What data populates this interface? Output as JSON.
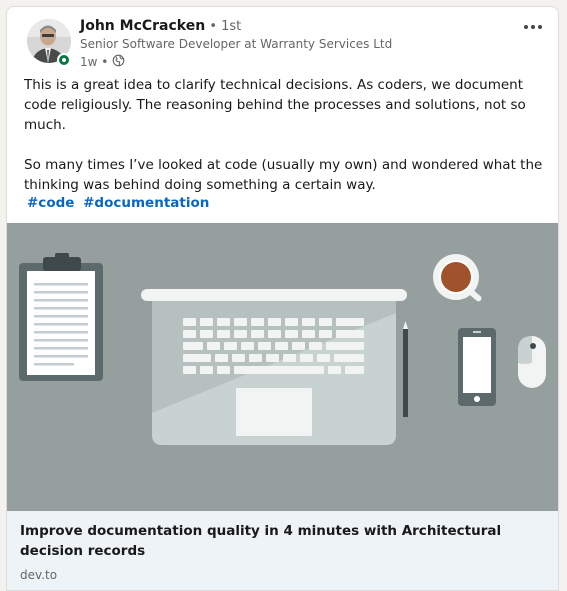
{
  "post": {
    "author": {
      "name": "John McCracken",
      "degree": " • 1st",
      "headline": "Senior Software Developer at Warranty Services Ltd",
      "time": "1w •",
      "visibility_icon": "globe-icon",
      "online": true
    },
    "menu_icon": "more-options-icon",
    "body": [
      "This is a great idea to clarify technical decisions. As coders, we document code religiously. The reasoning behind the processes and solutions, not so much.",
      "So many times I’ve looked at code (usually my own) and wondered what the thinking was behind doing something a certain way."
    ],
    "hashtags": [
      "#code",
      "#documentation"
    ],
    "link_preview": {
      "title": "Improve documentation quality in 4 minutes with Architectural decision records",
      "source": "dev.to"
    }
  },
  "colors": {
    "link": "#0a66c2",
    "online": "#057642",
    "hero_bg": "#949f9e",
    "preview_bg": "#eef3f8"
  }
}
